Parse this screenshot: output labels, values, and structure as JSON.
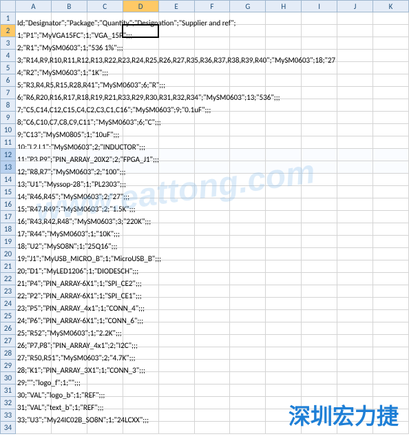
{
  "columns": [
    "A",
    "B",
    "C",
    "D",
    "E",
    "F",
    "G",
    "H",
    "I",
    "J",
    "K"
  ],
  "activeCell": {
    "row": 2,
    "col": "D"
  },
  "rows": [
    {
      "n": 1,
      "text": "Id;\"Designator\";\"Package\";\"Quantity\";\"Designation\";\"Supplier and ref\";"
    },
    {
      "n": 2,
      "text": "1;\"P1\";\"MyVGA15FC\";1;\"VGA_15P\";;;",
      "active": true
    },
    {
      "n": 3,
      "text": "2;\"R1\";\"MySM0603\";1;\"536 1%\";;;"
    },
    {
      "n": 4,
      "text": "3;\"R14,R9,R10,R11,R12,R13,R22,R23,R24,R25,R26,R27,R35,R36,R37,R38,R39,R40\";\"MySM0603\";18;\"27"
    },
    {
      "n": 5,
      "text": "4;\"R2\";\"MySM0603\";1;\"1K\";;;"
    },
    {
      "n": 6,
      "text": "5;\"R3,R4,R5,R15,R28,R41\";\"MySM0603\";6;\"R\";;;"
    },
    {
      "n": 7,
      "text": "6;\"R6,R20,R16,R17,R18,R19,R21,R33,R29,R30,R31,R32,R34\";\"MySM0603\";13;\"536\";;;"
    },
    {
      "n": 8,
      "text": "7;\"C5,C14,C12,C15,C4,C2,C3,C1,C16\";\"MySM0603\";9;\"0.1uF\";;;"
    },
    {
      "n": 9,
      "text": "8;\"C6,C10,C7,C8,C9,C11\";\"MySM0603\";6;\"C\";;;"
    },
    {
      "n": 10,
      "text": "9;\"C13\";\"MySM0805\";1;\"10uF\";;;"
    },
    {
      "n": 11,
      "text": "10;\"L2,L1\";\"MySM0603\";2;\"INDUCTOR\";;;"
    },
    {
      "n": 12,
      "text": "11;\"P3,P9\";\"PIN_ARRAY_20X2\";2;\"FPGA_J1\";;;",
      "hl": true
    },
    {
      "n": 13,
      "text": "12;\"R8,R7\";\"MySM0603\";2;\"100\";;;",
      "hl": true
    },
    {
      "n": 14,
      "text": "13;\"U1\";\"Myssop-28\";1;\"PL2303\";;;"
    },
    {
      "n": 15,
      "text": "14;\"R46,R45\";\"MySM0603\";2;\"27\";;;"
    },
    {
      "n": 16,
      "text": "15;\"R47,R49\";\"MySM0603\";2;\"1.5K\";;;"
    },
    {
      "n": 17,
      "text": "16;\"R43,R42,R48\";\"MySM0603\";3;\"220K\";;;"
    },
    {
      "n": 18,
      "text": "17;\"R44\";\"MySM0603\";1;\"10K\";;;"
    },
    {
      "n": 19,
      "text": "18;\"U2\";\"MySO8N\";1;\"25Q16\";;;"
    },
    {
      "n": 20,
      "text": "19;\"J1\";\"MyUSB_MICRO_B\";1;\"MicroUSB_B\";;;"
    },
    {
      "n": 21,
      "text": "20;\"D1\";\"MyLED1206\";1;\"DIODESCH\";;;"
    },
    {
      "n": 22,
      "text": "21;\"P4\";\"PIN_ARRAY-6X1\";1;\"SPI_CE2\";;;"
    },
    {
      "n": 23,
      "text": "22;\"P2\";\"PIN_ARRAY-6X1\";1;\"SPI_CE1\";;;"
    },
    {
      "n": 24,
      "text": "23;\"P5\";\"PIN_ARRAY_4x1\";1;\"CONN_4\";;;"
    },
    {
      "n": 25,
      "text": "24;\"P6\";\"PIN_ARRAY-6X1\";1;\"CONN_6\";;;"
    },
    {
      "n": 26,
      "text": "25;\"R52\";\"MySM0603\";1;\"2.2K\";;;"
    },
    {
      "n": 27,
      "text": "26;\"P7,P8\";\"PIN_ARRAY_4x1\";2;\"I2C\";;;"
    },
    {
      "n": 28,
      "text": "27;\"R50,R51\";\"MySM0603\";2;\"4.7K\";;;"
    },
    {
      "n": 29,
      "text": "28;\"K1\";\"PIN_ARRAY_3X1\";1;\"CONN_3\";;;"
    },
    {
      "n": 30,
      "text": "29;\"\";\"logo_f\";1;\"\";;;"
    },
    {
      "n": 31,
      "text": "30;\"VAL\";\"logo_b\";1;\"REF\";;;"
    },
    {
      "n": 32,
      "text": "31;\"VAL\";\"text_b\";1;\"REF\";;;"
    },
    {
      "n": 33,
      "text": "33;\"U3\";\"My24IC02B_SO8N\";1;\"24LCXX\";;;"
    },
    {
      "n": 34,
      "text": ""
    }
  ],
  "watermark1": "www.eattong.com",
  "watermark2": "深圳宏力捷"
}
